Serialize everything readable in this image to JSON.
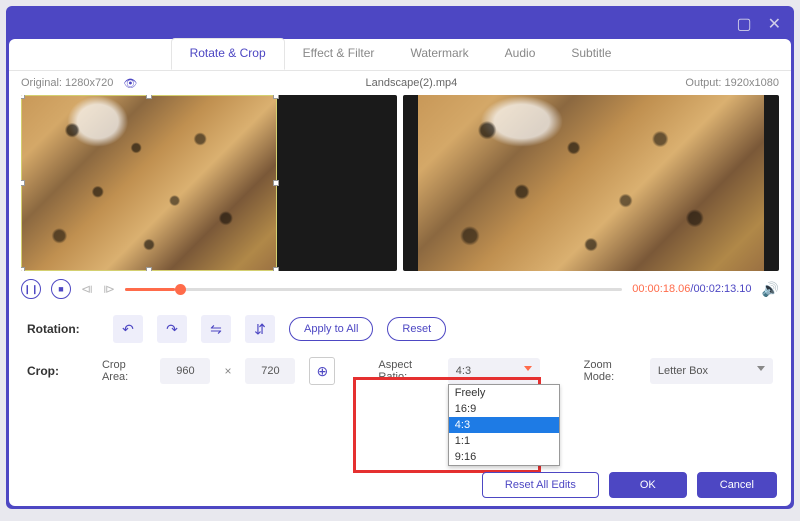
{
  "window": {
    "maximize": "▢",
    "close": "✕"
  },
  "tabs": [
    "Rotate & Crop",
    "Effect & Filter",
    "Watermark",
    "Audio",
    "Subtitle"
  ],
  "active_tab_index": 0,
  "infobar": {
    "original_label": "Original:",
    "original_res": "1280x720",
    "filename": "Landscape(2).mp4",
    "output_label": "Output:",
    "output_res": "1920x1080"
  },
  "player": {
    "current": "00:00:18.06",
    "total": "00:02:13.10"
  },
  "rotation": {
    "label": "Rotation:",
    "apply_all": "Apply to All",
    "reset": "Reset"
  },
  "crop": {
    "label": "Crop:",
    "area_label": "Crop Area:",
    "width": "960",
    "height": "720",
    "aspect_label": "Aspect Ratio:",
    "aspect_value": "4:3",
    "aspect_options": [
      "Freely",
      "16:9",
      "4:3",
      "1:1",
      "9:16"
    ],
    "aspect_selected_index": 2,
    "zoom_label": "Zoom Mode:",
    "zoom_value": "Letter Box"
  },
  "footer": {
    "reset_all": "Reset All Edits",
    "ok": "OK",
    "cancel": "Cancel"
  }
}
